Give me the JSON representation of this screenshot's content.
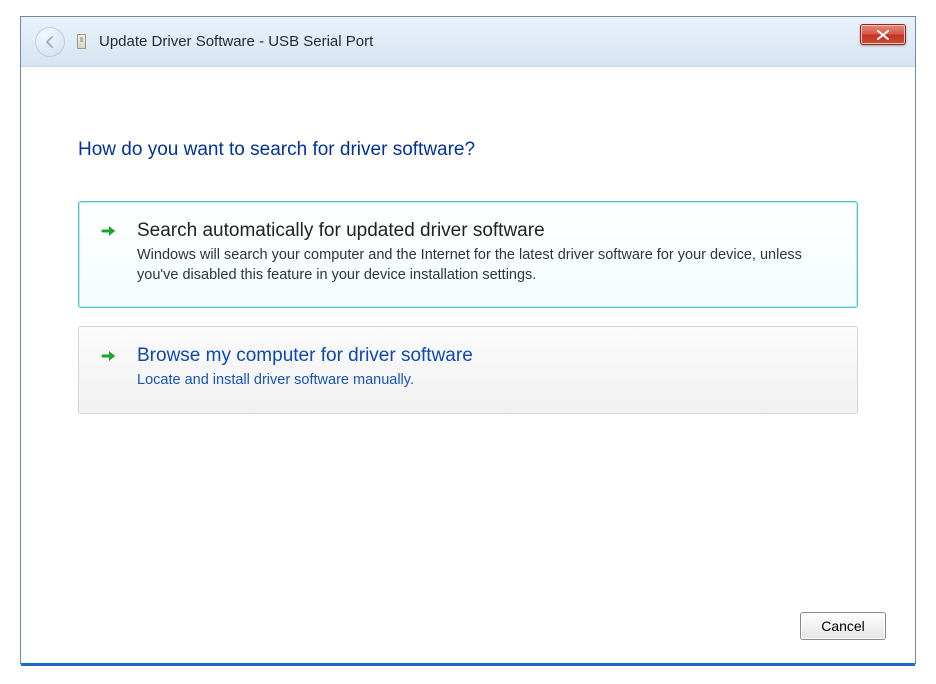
{
  "window": {
    "title": "Update Driver Software - USB Serial Port"
  },
  "page": {
    "heading": "How do you want to search for driver software?"
  },
  "options": [
    {
      "title": "Search automatically for updated driver software",
      "description": "Windows will search your computer and the Internet for the latest driver software for your device, unless you've disabled this feature in your device installation settings."
    },
    {
      "title": "Browse my computer for driver software",
      "description": "Locate and install driver software manually."
    }
  ],
  "buttons": {
    "cancel": "Cancel"
  }
}
